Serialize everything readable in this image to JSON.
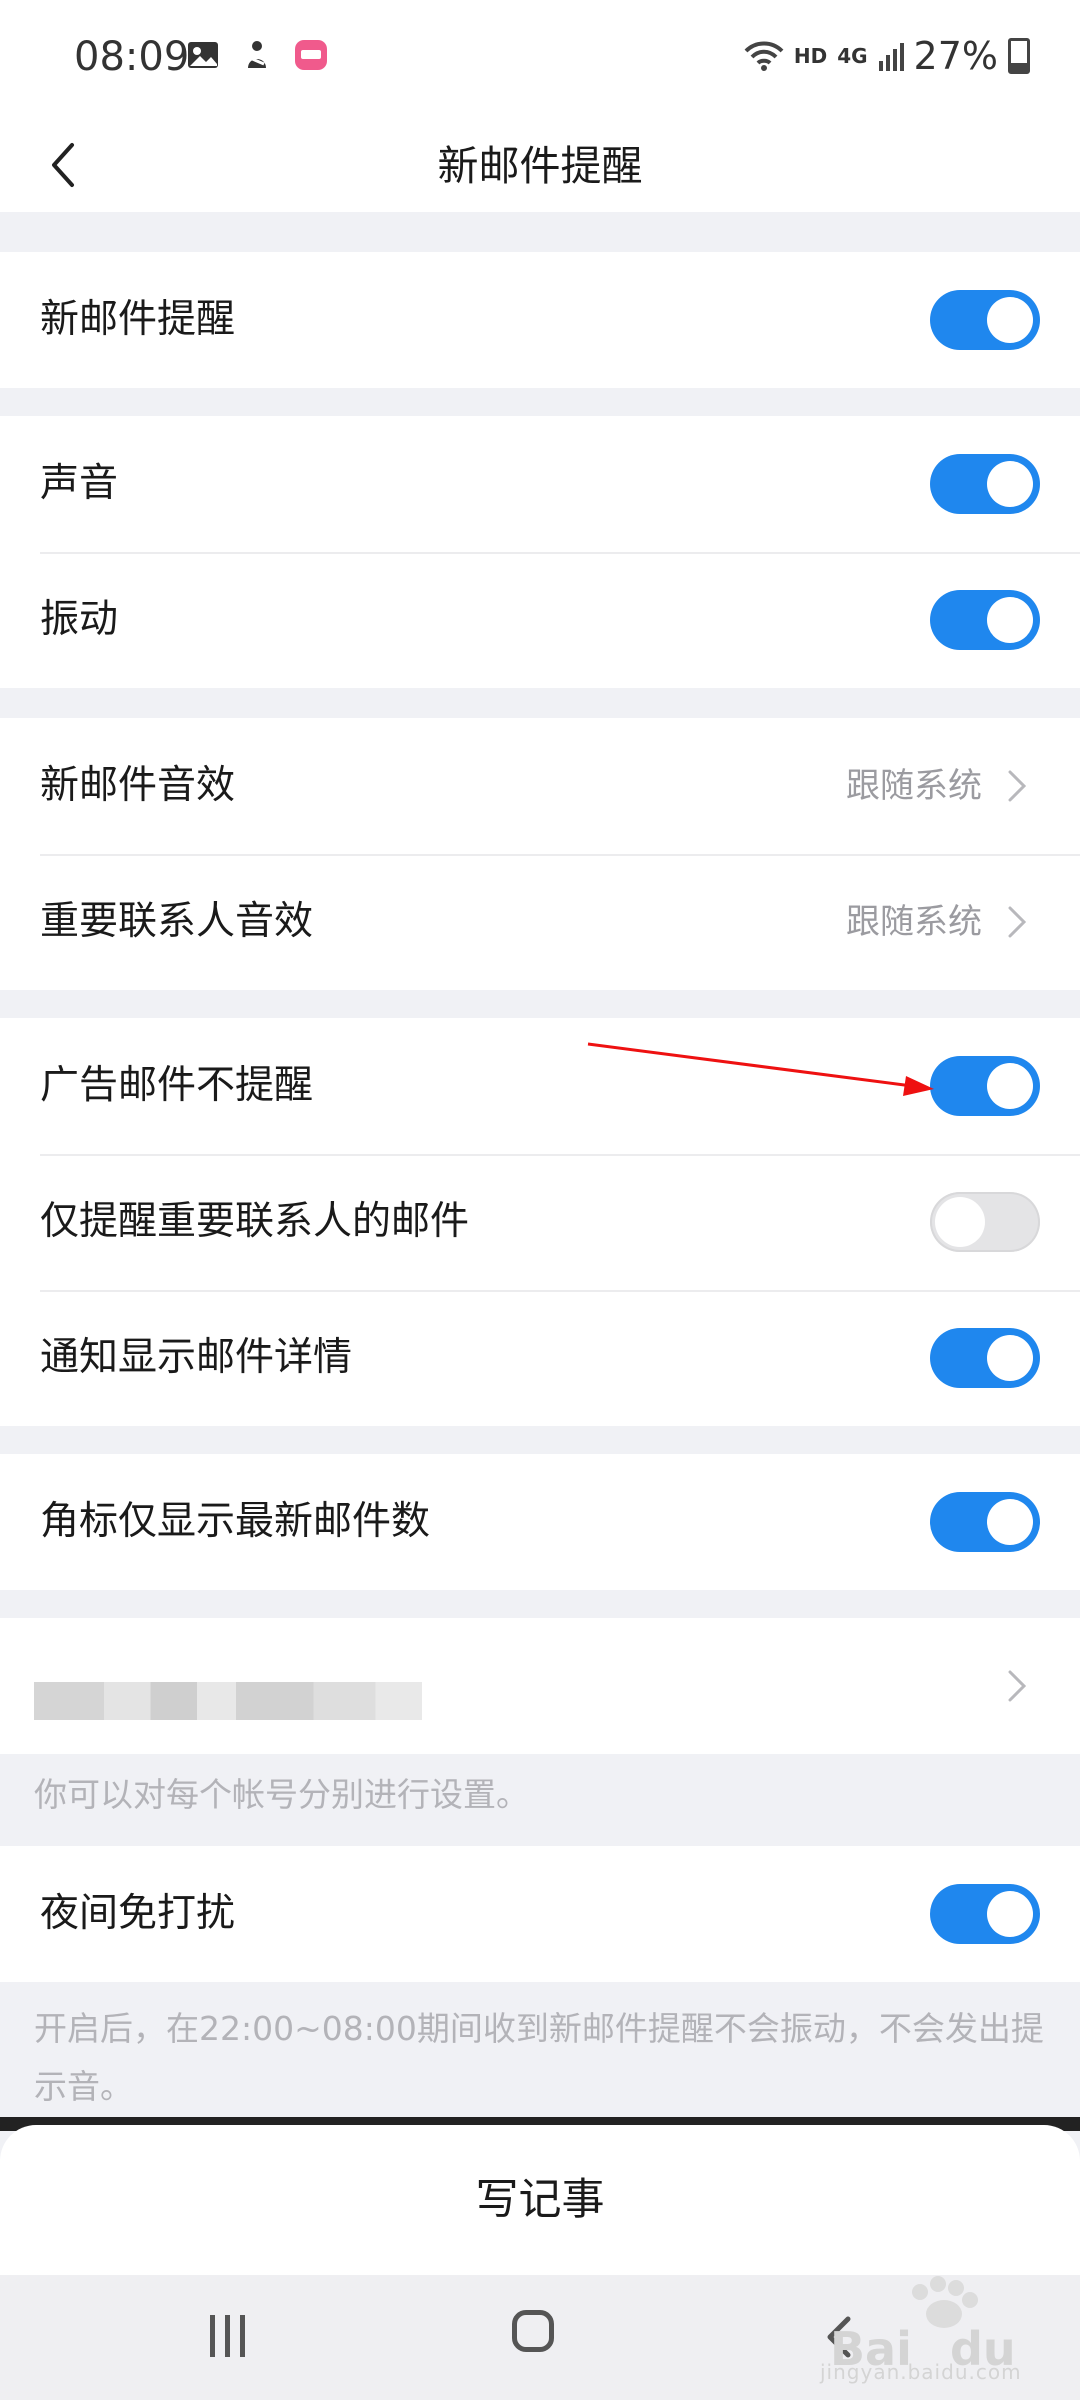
{
  "status_bar": {
    "time": "08:09",
    "hd": "HD",
    "network": "4G",
    "battery": "27%",
    "icons": [
      "gallery-icon",
      "app-icon",
      "pink-app-icon"
    ]
  },
  "header": {
    "title": "新邮件提醒",
    "back_icon": "chevron-left-icon"
  },
  "settings": {
    "new_mail_alert": {
      "label": "新邮件提醒",
      "enabled": true
    },
    "sound": {
      "label": "声音",
      "enabled": true
    },
    "vibrate": {
      "label": "振动",
      "enabled": true
    },
    "new_mail_sound": {
      "label": "新邮件音效",
      "value": "跟随系统"
    },
    "vip_sound": {
      "label": "重要联系人音效",
      "value": "跟随系统"
    },
    "ad_mail_no_alert": {
      "label": "广告邮件不提醒",
      "enabled": true
    },
    "vip_only": {
      "label": "仅提醒重要联系人的邮件",
      "enabled": false
    },
    "show_details": {
      "label": "通知显示邮件详情",
      "enabled": true
    },
    "badge_latest": {
      "label": "角标仅显示最新邮件数",
      "enabled": true
    },
    "account_note": "你可以对每个帐号分别进行设置。",
    "night_dnd": {
      "label": "夜间免打扰",
      "enabled": true
    },
    "night_note": "开启后，在22:00~08:00期间收到新邮件提醒不会振动，不会发出提示音。"
  },
  "bottom_sheet": {
    "write_note": "写记事"
  },
  "watermark": {
    "text": "jingyan.baidu.com"
  },
  "colors": {
    "toggle_on": "#1f87ee",
    "toggle_off": "#e4e4e6",
    "background": "#f0f1f5",
    "annotation_arrow": "#ee1111"
  }
}
